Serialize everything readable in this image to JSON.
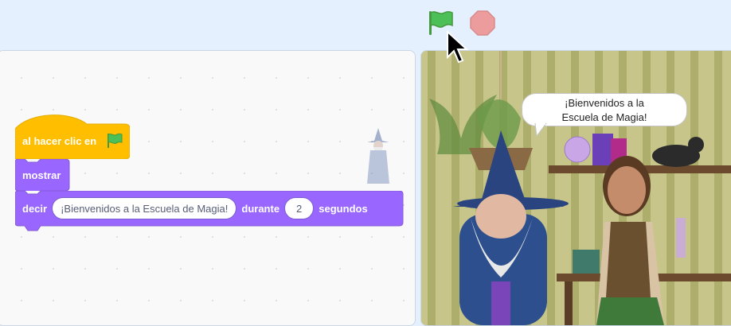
{
  "toolbar": {
    "green_flag_icon": "green-flag",
    "stop_icon": "stop-sign"
  },
  "code": {
    "hat_block": {
      "label": "al hacer clic en",
      "icon": "green-flag"
    },
    "show_block": {
      "label": "mostrar"
    },
    "say_block": {
      "label": "decir",
      "message": "¡Bienvenidos a la Escuela de Magia!",
      "for_label": "durante",
      "seconds": "2",
      "seconds_label": "segundos"
    }
  },
  "stage": {
    "speech_line1": "¡Bienvenidos a la",
    "speech_line2": "Escuela de Magia!"
  },
  "colors": {
    "events": "#ffbf00",
    "looks": "#9966ff",
    "green_flag": "#4cbf56",
    "stop": "#ec9c9c"
  }
}
